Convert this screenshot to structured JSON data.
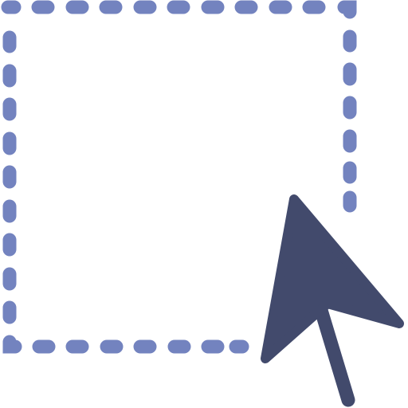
{
  "icon": {
    "name": "selection-cursor-icon",
    "parts": [
      "dashed-selection-rectangle",
      "arrow-pointer-cursor"
    ]
  },
  "colors": {
    "background": "#ffffff",
    "selection_dash": "#7383bf",
    "cursor": "#424a6c"
  }
}
